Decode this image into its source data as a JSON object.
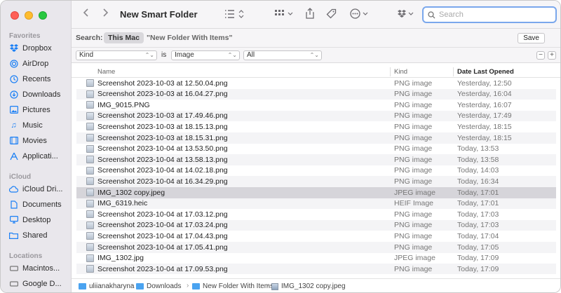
{
  "window": {
    "title": "New Smart Folder"
  },
  "sidebar": {
    "favorites_label": "Favorites",
    "favorites": [
      {
        "label": "Dropbox",
        "icon": "dropbox-icon"
      },
      {
        "label": "AirDrop",
        "icon": "airdrop-icon"
      },
      {
        "label": "Recents",
        "icon": "clock-icon"
      },
      {
        "label": "Downloads",
        "icon": "download-icon"
      },
      {
        "label": "Pictures",
        "icon": "picture-icon"
      },
      {
        "label": "Music",
        "icon": "music-note-icon"
      },
      {
        "label": "Movies",
        "icon": "film-icon"
      },
      {
        "label": "Applicati...",
        "icon": "applications-icon"
      }
    ],
    "icloud_label": "iCloud",
    "icloud": [
      {
        "label": "iCloud Dri...",
        "icon": "cloud-icon"
      },
      {
        "label": "Documents",
        "icon": "document-icon"
      },
      {
        "label": "Desktop",
        "icon": "desktop-icon"
      },
      {
        "label": "Shared",
        "icon": "shared-folder-icon"
      }
    ],
    "locations_label": "Locations",
    "locations": [
      {
        "label": "Macintos...",
        "icon": "disk-icon"
      },
      {
        "label": "Google D...",
        "icon": "drive-icon"
      }
    ]
  },
  "toolbar": {
    "search_placeholder": "Search"
  },
  "scope": {
    "label": "Search:",
    "this_mac": "This Mac",
    "other": "\"New Folder With Items\"",
    "save": "Save"
  },
  "criteria": {
    "attribute": "Kind",
    "operator": "is",
    "value": "Image",
    "subvalue": "All",
    "remove": "−",
    "add": "+"
  },
  "table": {
    "columns": {
      "name": "Name",
      "kind": "Kind",
      "date": "Date Last Opened"
    },
    "rows": [
      {
        "name": "Screenshot 2023-10-03 at 12.50.04.png",
        "kind": "PNG image",
        "date": "Yesterday, 12:50"
      },
      {
        "name": "Screenshot 2023-10-03 at 16.04.27.png",
        "kind": "PNG image",
        "date": "Yesterday, 16:04"
      },
      {
        "name": "IMG_9015.PNG",
        "kind": "PNG image",
        "date": "Yesterday, 16:07"
      },
      {
        "name": "Screenshot 2023-10-03 at 17.49.46.png",
        "kind": "PNG image",
        "date": "Yesterday, 17:49"
      },
      {
        "name": "Screenshot 2023-10-03 at 18.15.13.png",
        "kind": "PNG image",
        "date": "Yesterday, 18:15"
      },
      {
        "name": "Screenshot 2023-10-03 at 18.15.31.png",
        "kind": "PNG image",
        "date": "Yesterday, 18:15"
      },
      {
        "name": "Screenshot 2023-10-04 at 13.53.50.png",
        "kind": "PNG image",
        "date": "Today, 13:53"
      },
      {
        "name": "Screenshot 2023-10-04 at 13.58.13.png",
        "kind": "PNG image",
        "date": "Today, 13:58"
      },
      {
        "name": "Screenshot 2023-10-04 at 14.02.18.png",
        "kind": "PNG image",
        "date": "Today, 14:03"
      },
      {
        "name": "Screenshot 2023-10-04 at 16.34.29.png",
        "kind": "PNG image",
        "date": "Today, 16:34"
      },
      {
        "name": "IMG_1302 copy.jpeg",
        "kind": "JPEG image",
        "date": "Today, 17:01",
        "selected": true
      },
      {
        "name": "IMG_6319.heic",
        "kind": "HEIF Image",
        "date": "Today, 17:01"
      },
      {
        "name": "Screenshot 2023-10-04 at 17.03.12.png",
        "kind": "PNG image",
        "date": "Today, 17:03"
      },
      {
        "name": "Screenshot 2023-10-04 at 17.03.24.png",
        "kind": "PNG image",
        "date": "Today, 17:03"
      },
      {
        "name": "Screenshot 2023-10-04 at 17.04.43.png",
        "kind": "PNG image",
        "date": "Today, 17:04"
      },
      {
        "name": "Screenshot 2023-10-04 at 17.05.41.png",
        "kind": "PNG image",
        "date": "Today, 17:05"
      },
      {
        "name": "IMG_1302.jpg",
        "kind": "JPEG image",
        "date": "Today, 17:09"
      },
      {
        "name": "Screenshot 2023-10-04 at 17.09.53.png",
        "kind": "PNG image",
        "date": "Today, 17:09"
      }
    ]
  },
  "pathbar": {
    "crumbs": [
      "uliianakharyna",
      "Downloads",
      "New Folder With Items",
      "IMG_1302 copy.jpeg"
    ]
  },
  "colors": {
    "accent": "#1a7ff5",
    "selection": "#d6d5da",
    "search_ring": "#7aa7ec"
  }
}
